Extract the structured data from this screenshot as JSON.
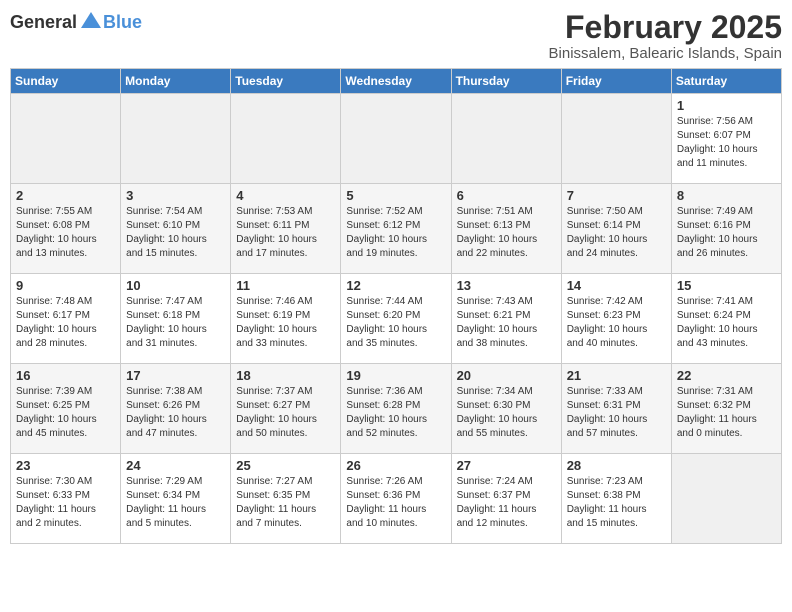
{
  "header": {
    "logo_general": "General",
    "logo_blue": "Blue",
    "month": "February 2025",
    "location": "Binissalem, Balearic Islands, Spain"
  },
  "days_of_week": [
    "Sunday",
    "Monday",
    "Tuesday",
    "Wednesday",
    "Thursday",
    "Friday",
    "Saturday"
  ],
  "weeks": [
    [
      {
        "num": "",
        "info": ""
      },
      {
        "num": "",
        "info": ""
      },
      {
        "num": "",
        "info": ""
      },
      {
        "num": "",
        "info": ""
      },
      {
        "num": "",
        "info": ""
      },
      {
        "num": "",
        "info": ""
      },
      {
        "num": "1",
        "info": "Sunrise: 7:56 AM\nSunset: 6:07 PM\nDaylight: 10 hours\nand 11 minutes."
      }
    ],
    [
      {
        "num": "2",
        "info": "Sunrise: 7:55 AM\nSunset: 6:08 PM\nDaylight: 10 hours\nand 13 minutes."
      },
      {
        "num": "3",
        "info": "Sunrise: 7:54 AM\nSunset: 6:10 PM\nDaylight: 10 hours\nand 15 minutes."
      },
      {
        "num": "4",
        "info": "Sunrise: 7:53 AM\nSunset: 6:11 PM\nDaylight: 10 hours\nand 17 minutes."
      },
      {
        "num": "5",
        "info": "Sunrise: 7:52 AM\nSunset: 6:12 PM\nDaylight: 10 hours\nand 19 minutes."
      },
      {
        "num": "6",
        "info": "Sunrise: 7:51 AM\nSunset: 6:13 PM\nDaylight: 10 hours\nand 22 minutes."
      },
      {
        "num": "7",
        "info": "Sunrise: 7:50 AM\nSunset: 6:14 PM\nDaylight: 10 hours\nand 24 minutes."
      },
      {
        "num": "8",
        "info": "Sunrise: 7:49 AM\nSunset: 6:16 PM\nDaylight: 10 hours\nand 26 minutes."
      }
    ],
    [
      {
        "num": "9",
        "info": "Sunrise: 7:48 AM\nSunset: 6:17 PM\nDaylight: 10 hours\nand 28 minutes."
      },
      {
        "num": "10",
        "info": "Sunrise: 7:47 AM\nSunset: 6:18 PM\nDaylight: 10 hours\nand 31 minutes."
      },
      {
        "num": "11",
        "info": "Sunrise: 7:46 AM\nSunset: 6:19 PM\nDaylight: 10 hours\nand 33 minutes."
      },
      {
        "num": "12",
        "info": "Sunrise: 7:44 AM\nSunset: 6:20 PM\nDaylight: 10 hours\nand 35 minutes."
      },
      {
        "num": "13",
        "info": "Sunrise: 7:43 AM\nSunset: 6:21 PM\nDaylight: 10 hours\nand 38 minutes."
      },
      {
        "num": "14",
        "info": "Sunrise: 7:42 AM\nSunset: 6:23 PM\nDaylight: 10 hours\nand 40 minutes."
      },
      {
        "num": "15",
        "info": "Sunrise: 7:41 AM\nSunset: 6:24 PM\nDaylight: 10 hours\nand 43 minutes."
      }
    ],
    [
      {
        "num": "16",
        "info": "Sunrise: 7:39 AM\nSunset: 6:25 PM\nDaylight: 10 hours\nand 45 minutes."
      },
      {
        "num": "17",
        "info": "Sunrise: 7:38 AM\nSunset: 6:26 PM\nDaylight: 10 hours\nand 47 minutes."
      },
      {
        "num": "18",
        "info": "Sunrise: 7:37 AM\nSunset: 6:27 PM\nDaylight: 10 hours\nand 50 minutes."
      },
      {
        "num": "19",
        "info": "Sunrise: 7:36 AM\nSunset: 6:28 PM\nDaylight: 10 hours\nand 52 minutes."
      },
      {
        "num": "20",
        "info": "Sunrise: 7:34 AM\nSunset: 6:30 PM\nDaylight: 10 hours\nand 55 minutes."
      },
      {
        "num": "21",
        "info": "Sunrise: 7:33 AM\nSunset: 6:31 PM\nDaylight: 10 hours\nand 57 minutes."
      },
      {
        "num": "22",
        "info": "Sunrise: 7:31 AM\nSunset: 6:32 PM\nDaylight: 11 hours\nand 0 minutes."
      }
    ],
    [
      {
        "num": "23",
        "info": "Sunrise: 7:30 AM\nSunset: 6:33 PM\nDaylight: 11 hours\nand 2 minutes."
      },
      {
        "num": "24",
        "info": "Sunrise: 7:29 AM\nSunset: 6:34 PM\nDaylight: 11 hours\nand 5 minutes."
      },
      {
        "num": "25",
        "info": "Sunrise: 7:27 AM\nSunset: 6:35 PM\nDaylight: 11 hours\nand 7 minutes."
      },
      {
        "num": "26",
        "info": "Sunrise: 7:26 AM\nSunset: 6:36 PM\nDaylight: 11 hours\nand 10 minutes."
      },
      {
        "num": "27",
        "info": "Sunrise: 7:24 AM\nSunset: 6:37 PM\nDaylight: 11 hours\nand 12 minutes."
      },
      {
        "num": "28",
        "info": "Sunrise: 7:23 AM\nSunset: 6:38 PM\nDaylight: 11 hours\nand 15 minutes."
      },
      {
        "num": "",
        "info": ""
      }
    ]
  ]
}
